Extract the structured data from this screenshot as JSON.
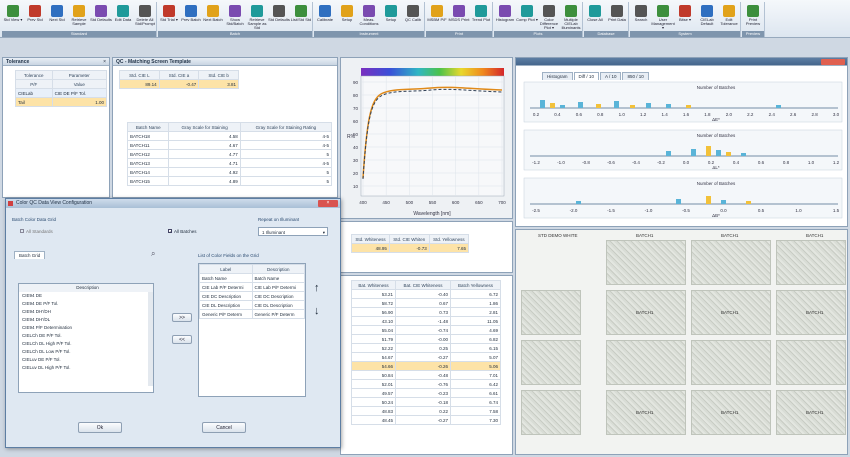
{
  "app": {
    "title_bar_color": "#3e5c7f"
  },
  "ribbon": {
    "groups": [
      {
        "label": "Standard",
        "buttons": [
          "Std View ▾",
          "Prev Std",
          "Next Std",
          "Retrieve Sample",
          "Std Defaults",
          "Edit Data",
          "Delete All Std/Prompt"
        ]
      },
      {
        "label": "Batch",
        "buttons": [
          "Std Trial ▾",
          "Prev Batch",
          "Next Batch",
          "Show Std/Batch",
          "Retrieve Sample as Std",
          "Std Defaults",
          "List/Std Std"
        ]
      },
      {
        "label": "Instrument",
        "buttons": [
          "Calibrate",
          "Setup",
          "Meas. Conditions",
          "Setup",
          "QC Calib"
        ]
      },
      {
        "label": "Print",
        "buttons": [
          "MSBM P/F",
          "MSDS Print",
          "Trend Plot"
        ]
      },
      {
        "label": "Plots",
        "buttons": [
          "Histogram",
          "Comp Plot ▾",
          "Color Difference Plot ▾",
          "Multiple CIELab Illuminants"
        ]
      },
      {
        "label": "Database",
        "buttons": [
          "Close All",
          "Print Data"
        ]
      },
      {
        "label": "System",
        "buttons": [
          "Search",
          "User Management ▾",
          "Bitse ▾",
          "CIELab Default",
          "Edit Tolerance"
        ]
      },
      {
        "label": "Preview",
        "buttons": [
          "Print Preview"
        ]
      }
    ]
  },
  "tolerance_panel": {
    "title": "Tolerance",
    "headers": [
      "Tolerance",
      "Parameter"
    ],
    "row2": [
      "P/F",
      "Value"
    ],
    "rows": [
      [
        "CIELab",
        "CIE DE P/F Tol."
      ],
      [
        "Tail",
        "1.00"
      ]
    ]
  },
  "qc_window": {
    "title": "QC - Matching Screen Template",
    "std_headers": [
      "Std. CIE L",
      "Std. CIE a",
      "Std. CIE b"
    ],
    "std_values": [
      "89.14",
      "-0.47",
      "3.81"
    ],
    "batch_headers": [
      "Batch Name",
      "Gray Scale for Staining",
      "Gray Scale for Staining Rating"
    ],
    "batches": [
      [
        "BATCH18",
        "4.58",
        "4-5"
      ],
      [
        "BATCH11",
        "4.67",
        "4-5"
      ],
      [
        "BATCH12",
        "4.77",
        "5"
      ],
      [
        "BATCH13",
        "4.71",
        "4-5"
      ],
      [
        "BATCH14",
        "4.92",
        "5"
      ],
      [
        "BATCH15",
        "4.89",
        "5"
      ]
    ]
  },
  "dialog": {
    "title": "Color QC Data View Configuration",
    "batch_color_grid": "Batch Color Data Grid",
    "all_standards": "All Standards",
    "all_batches": "All Batches",
    "repeat_label": "Repeat on Illuminant",
    "repeat_value": "1 Illuminant",
    "batch_grid_tab": "Batch Grid",
    "desc_header": "Description",
    "available": [
      "CIE94 DE",
      "CIE94 DE P/F Tol.",
      "CIE94 DH'/DH",
      "CIE94 DH'/DL",
      "CIE94 P/F Determination",
      "CIELCh DE P/F Tol.",
      "CIELCh DL High P/F Tol.",
      "CIELCh DL Low P/F Tol.",
      "CIELuv DE P/F Tol.",
      "CIELuv DL High P/F Tol."
    ],
    "fields_title": "List of Color Fields on the Grid",
    "fields_headers": [
      "Label",
      "Description"
    ],
    "fields": [
      [
        "Batch Name",
        "Batch Name"
      ],
      [
        "CIE Lab P/F Determi",
        "CIE Lab P/F Determi"
      ],
      [
        "CIE DC Description",
        "CIE DC Description"
      ],
      [
        "CIE DL Description",
        "CIE DL Description"
      ],
      [
        "Generic P/F Determ",
        "Generic P/F Determ"
      ]
    ],
    "move_right": ">>",
    "move_left": "<<",
    "up_arrow": "↑",
    "down_arrow": "↓",
    "ok": "Ok",
    "cancel": "Cancel"
  },
  "spectral_plot": {
    "x_ticks": [
      "400",
      "450",
      "500",
      "550",
      "600",
      "650",
      "700"
    ],
    "xlabel": "Wavelength [nm]",
    "y_ticks": [
      "90",
      "80",
      "70",
      "60",
      "50",
      "40",
      "30",
      "20",
      "10"
    ],
    "ylabel": "R%"
  },
  "whiteness_small": {
    "headers": [
      "Std. Whiteness",
      "Std. CIE Whiten",
      "Std. Yellowness"
    ],
    "values": [
      "48.95",
      "-0.73",
      "7.65"
    ]
  },
  "whiteness_table": {
    "headers": [
      "Bat. Whiteness",
      "Bat. CIE Whiteness",
      "Batch Yellowness"
    ],
    "rows": [
      [
        "53.21",
        "-0.40",
        "6.72"
      ],
      [
        "58.72",
        "0.67",
        "1.86"
      ],
      [
        "56.90",
        "0.73",
        "2.81"
      ],
      [
        "43.10",
        "-1.48",
        "11.05"
      ],
      [
        "55.04",
        "-0.74",
        "4.69"
      ],
      [
        "51.79",
        "-0.00",
        "6.82"
      ],
      [
        "52.22",
        "0.25",
        "6.15"
      ],
      [
        "54.67",
        "-0.27",
        "5.07"
      ],
      [
        "54.66",
        "-0.26",
        "5.06"
      ],
      [
        "50.84",
        "-0.48",
        "7.01"
      ],
      [
        "52.01",
        "-0.76",
        "6.42"
      ],
      [
        "49.57",
        "-0.23",
        "6.61"
      ],
      [
        "50.24",
        "-0.18",
        "6.74"
      ],
      [
        "48.83",
        "0.22",
        "7.58"
      ],
      [
        "48.45",
        "-0.27",
        "7.30"
      ]
    ],
    "highlight_index": 8
  },
  "histogram": {
    "tabs": [
      "Histogram",
      "Diff / 10",
      "A / 10",
      "850 / 10"
    ],
    "title1": "Number of Batches",
    "axis1": [
      "0.2",
      "0.4",
      "0.6",
      "0.8",
      "1.0",
      "1.2",
      "1.4",
      "1.6",
      "1.8",
      "2.0",
      "2.2",
      "2.4",
      "2.6",
      "2.8",
      "3.0"
    ],
    "label1": "ΔE*",
    "title2": "Number of Batches",
    "axis2": [
      "-1.2",
      "-1.0",
      "-0.8",
      "-0.6",
      "-0.4",
      "-0.2",
      "0.0",
      "0.2",
      "0.4",
      "0.6",
      "0.8",
      "1.0",
      "1.2"
    ],
    "label2": "ΔL*",
    "title3": "Number of Batches",
    "axis3": [
      "-2.5",
      "-2.0",
      "-1.5",
      "-1.0",
      "-0.5",
      "0.0",
      "0.5",
      "1.0",
      "1.5"
    ],
    "label3": "ΔB*"
  },
  "thumbnails": {
    "std_label": "STD DEMO WHITE",
    "batch_label": "BATCH1"
  },
  "colors": {
    "highlight": "#fde3a7",
    "accent": "#f0a020",
    "bar_blue": "#5ab4d8",
    "bar_yellow": "#f2c13a"
  }
}
